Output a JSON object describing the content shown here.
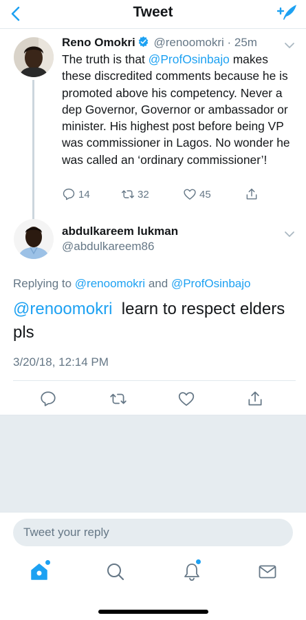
{
  "nav": {
    "title": "Tweet",
    "back_icon": "chevron-left-icon",
    "compose_icon": "compose-tweet-icon"
  },
  "parent_tweet": {
    "name": "Reno Omokri",
    "verified": true,
    "handle_time": "@renoomokri · 25m",
    "text_segments": [
      {
        "text": "The truth is that ",
        "mention": false
      },
      {
        "text": "@ProfOsinbajo",
        "mention": true
      },
      {
        "text": " makes these discredited comments because he is promoted above his competency. Never a dep Governor, Governor or ambassador or minister. His highest post before being VP was commissioner in Lagos. No wonder he was called an ‘ordinary commissioner’!",
        "mention": false
      }
    ],
    "reply_count": "14",
    "retweet_count": "32",
    "like_count": "45"
  },
  "reply_tweet": {
    "name": "abdulkareem lukman",
    "handle": "@abdulkareem86",
    "replying_label": "Replying to",
    "replying_to_1": "@renoomokri",
    "replying_and": "and",
    "replying_to_2": "@ProfOsinbajo",
    "mention": "@renoomokri",
    "text": "learn to respect elders pls",
    "date": "3/20/18, 12:14 PM"
  },
  "composer": {
    "placeholder": "Tweet your reply"
  },
  "tabbar": {
    "items": [
      "home-icon",
      "search-icon",
      "notifications-icon",
      "messages-icon"
    ],
    "home_dot": true,
    "notifications_dot": true
  },
  "colors": {
    "accent": "#1da1f2",
    "text": "#14171a",
    "secondary": "#657786",
    "divider": "#e1e8ed",
    "background_gray": "#e6ecf0"
  }
}
